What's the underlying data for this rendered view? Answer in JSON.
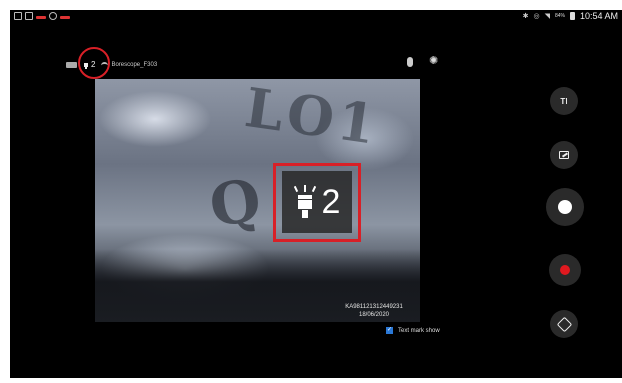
{
  "status_bar": {
    "time": "10:54 AM",
    "battery_percent": "84%",
    "icons": [
      "notification-icon",
      "gallery-icon",
      "battery-saver-icon",
      "settings-icon",
      "bluetooth-icon",
      "alarm-icon",
      "wifi-icon",
      "battery-icon"
    ]
  },
  "toolbar": {
    "light_level": "2",
    "device_name": "Borescope_F303",
    "icons": [
      "device-battery-icon",
      "light-icon",
      "wifi-icon",
      "microphone-icon",
      "gear-icon"
    ]
  },
  "camera": {
    "overlay_light_level": "2",
    "serial": "KA981121312449231",
    "date": "18/06/2020"
  },
  "text_mark": {
    "label": "Text mark show",
    "checked": true
  },
  "controls": {
    "text_button_label": "T",
    "icons": [
      "text-edit-icon",
      "draw-icon",
      "capture-icon",
      "record-icon",
      "rotate-icon"
    ],
    "capture_color": "#ffffff",
    "record_color": "#e0191f"
  },
  "annotation_color": "#d82027"
}
